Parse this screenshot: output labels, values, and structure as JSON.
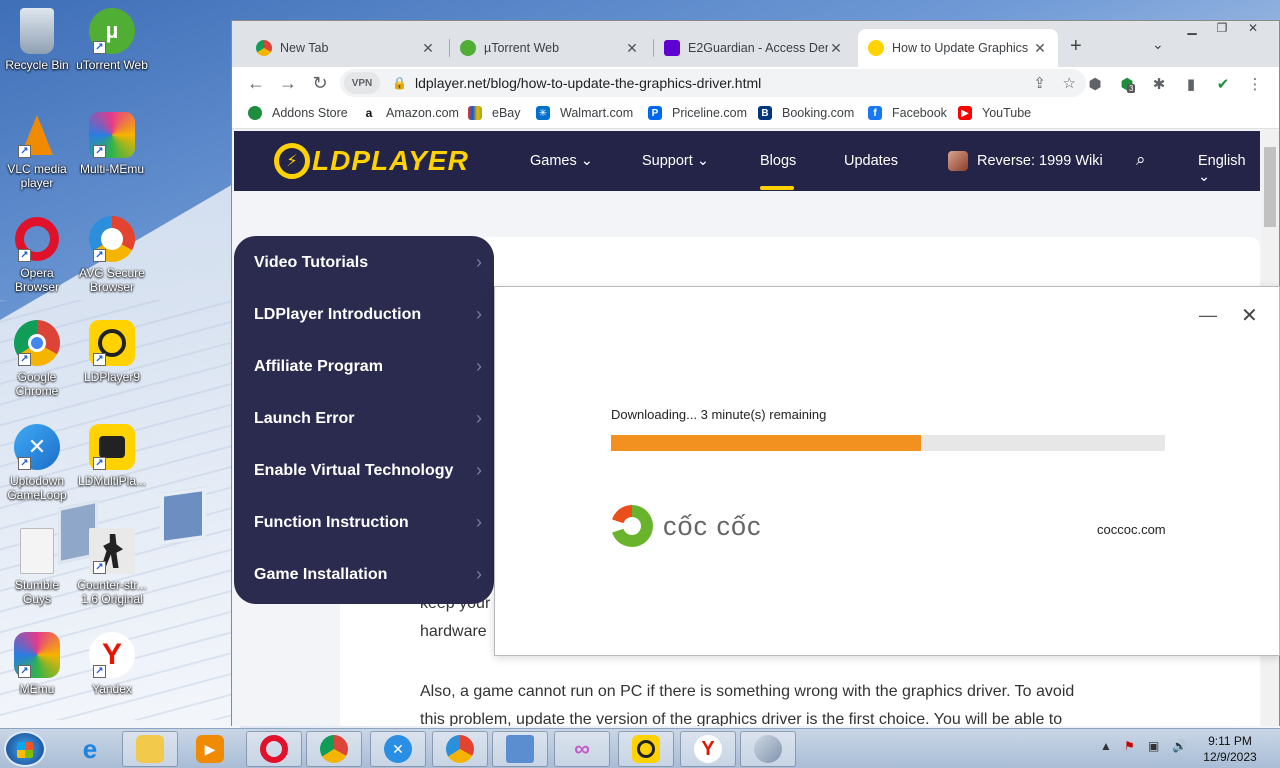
{
  "desktop": {
    "icons": [
      {
        "label": "Recycle Bin"
      },
      {
        "label": "uTorrent Web"
      },
      {
        "label": "VLC media player"
      },
      {
        "label": "Multi-MEmu"
      },
      {
        "label": "Opera Browser"
      },
      {
        "label": "AVG Secure Browser"
      },
      {
        "label": "Google Chrome"
      },
      {
        "label": "LDPlayer9"
      },
      {
        "label": "Uptodown GameLoop"
      },
      {
        "label": "LDMultiPla..."
      },
      {
        "label": "Stumble Guys"
      },
      {
        "label": "Counter-str... 1.6 Original"
      },
      {
        "label": "MEmu"
      },
      {
        "label": "Yandex"
      }
    ]
  },
  "browser": {
    "tabs": [
      {
        "title": "New Tab"
      },
      {
        "title": "µTorrent Web"
      },
      {
        "title": "E2Guardian - Access Denied"
      },
      {
        "title": "How to Update Graphics Driver"
      }
    ],
    "vpn_label": "VPN",
    "url": "ldplayer.net/blog/how-to-update-the-graphics-driver.html",
    "extension_badge": "3",
    "bookmarks": [
      {
        "label": "Addons Store"
      },
      {
        "label": "Amazon.com"
      },
      {
        "label": "eBay"
      },
      {
        "label": "Walmart.com"
      },
      {
        "label": "Priceline.com"
      },
      {
        "label": "Booking.com"
      },
      {
        "label": "Facebook"
      },
      {
        "label": "YouTube"
      }
    ]
  },
  "site": {
    "logo": "LDPLAYER",
    "nav": {
      "games": "Games",
      "support": "Support",
      "blogs": "Blogs",
      "updates": "Updates",
      "wiki": "Reverse: 1999 Wiki",
      "language": "English"
    },
    "side_menu": [
      {
        "label": "Video Tutorials"
      },
      {
        "label": "LDPlayer Introduction"
      },
      {
        "label": "Affiliate Program"
      },
      {
        "label": "Launch Error"
      },
      {
        "label": "Enable Virtual Technology"
      },
      {
        "label": "Function Instruction"
      },
      {
        "label": "Game Installation"
      }
    ],
    "article": {
      "fragment_1": "keep your",
      "fragment_2": "hardware",
      "paragraph": "Also, a game cannot run on PC if there is something wrong with the graphics driver. To avoid",
      "paragraph_2": "this problem, update the version of the graphics driver is the first choice. You will be able to"
    }
  },
  "download_popup": {
    "status": "Downloading... 3 minute(s) remaining",
    "progress": 0.56,
    "brand": "cốc cốc",
    "brand_url": "coccoc.com"
  },
  "taskbar": {
    "time": "9:11 PM",
    "date": "12/9/2023"
  },
  "colors": {
    "ld_nav_bg": "#232447",
    "ld_accent": "#ffd200",
    "progress_fill": "#f39120"
  }
}
